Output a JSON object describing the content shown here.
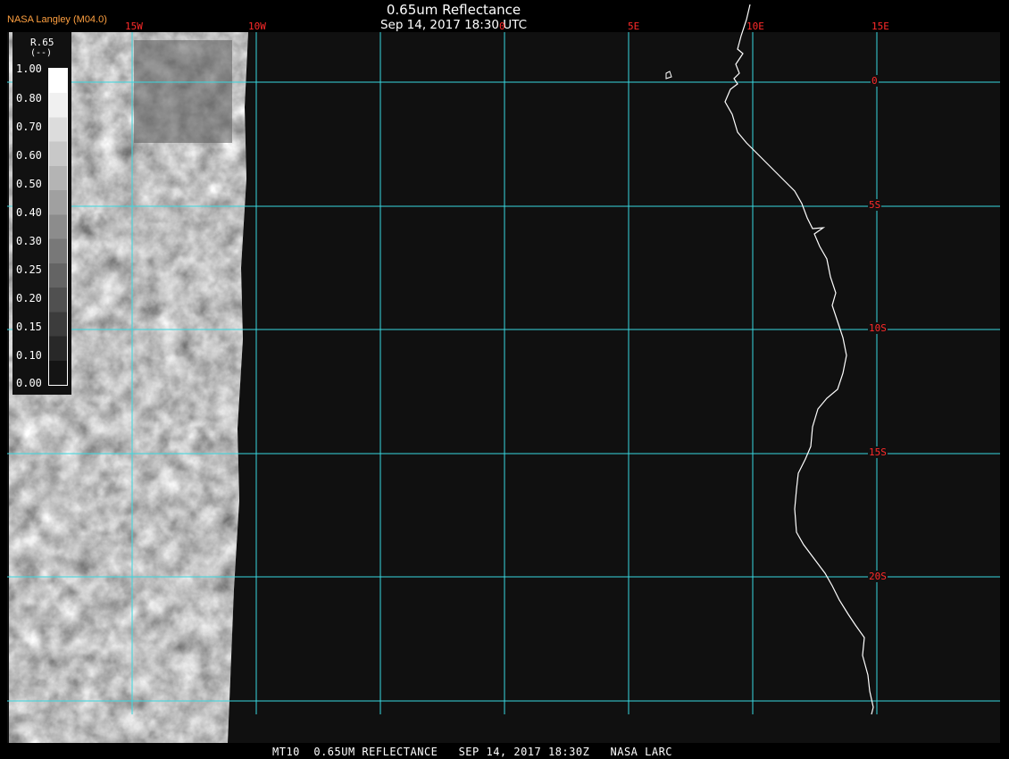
{
  "title": "0.65um Reflectance",
  "subtitle": "Sep 14, 2017 18:30 UTC",
  "credit": "NASA Langley (M04.0)",
  "footer": "MT10  0.65UM REFLECTANCE   SEP 14, 2017 18:30Z   NASA LARC",
  "lon_labels": [
    "15W",
    "10W",
    "0",
    "5E",
    "10E",
    "15E"
  ],
  "lat_labels": [
    "0",
    "5S",
    "10S",
    "15S",
    "20S"
  ],
  "legend": {
    "variable": "R.65",
    "unit": "(--)",
    "ticks": [
      "1.00",
      "0.80",
      "0.70",
      "0.60",
      "0.50",
      "0.40",
      "0.30",
      "0.25",
      "0.20",
      "0.15",
      "0.10",
      "0.00"
    ],
    "palette": [
      "#ffffff",
      "#f0f0f0",
      "#dcdcdc",
      "#c8c8c8",
      "#b4b4b4",
      "#a0a0a0",
      "#8c8c8c",
      "#787878",
      "#646464",
      "#505050",
      "#3c3c3c",
      "#282828",
      "#141414"
    ]
  },
  "colors": {
    "grid": "#39d8e0",
    "coast": "#ffffff",
    "labels": "#ff2a2a",
    "background": "#101010"
  }
}
